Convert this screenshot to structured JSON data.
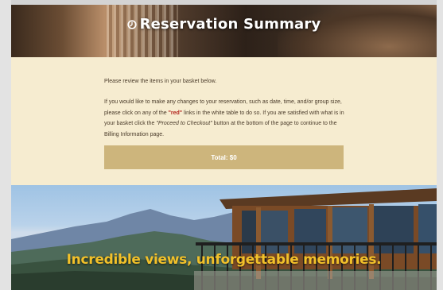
{
  "header": {
    "title": "Reservation Summary",
    "icon": "clock-icon"
  },
  "content": {
    "intro": "Please review the items in your basket below.",
    "instructions_part1": "If you would like to make any changes to your reservation, such as date, time, and/or group size, please click on any of the ",
    "red_link_text": "\"red\"",
    "instructions_part2": " links in the white table to do so. If you are satisfied with what is in your basket click the ",
    "checkout_text": "\"Proceed to Checkout\"",
    "instructions_part3": " button at the bottom of the page to continue to the Billing Information page.",
    "total_label": "Total: $0"
  },
  "footer": {
    "tagline": "Incredible views, unforgettable memories."
  },
  "colors": {
    "card_bg": "#f6ecd0",
    "total_button": "#cdb57c",
    "link_red": "#b3261e",
    "tagline_gold": "#f2c12a"
  }
}
